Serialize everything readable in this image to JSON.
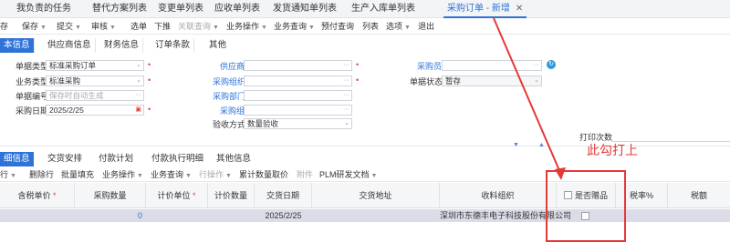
{
  "doc_tabs": [
    {
      "label": "我负责的任务"
    },
    {
      "label": "替代方案列表"
    },
    {
      "label": "变更单列表"
    },
    {
      "label": "应收单列表"
    },
    {
      "label": "发货通知单列表"
    },
    {
      "label": "生产入库单列表"
    },
    {
      "label": "采购订单 - 新增",
      "active": true
    }
  ],
  "toolbar": {
    "items": [
      "存",
      "保存",
      "提交",
      "审核",
      "选单",
      "下推",
      "关联查询",
      "业务操作",
      "业务查询",
      "预付查询",
      "列表",
      "选项",
      "退出"
    ]
  },
  "sections": [
    "本信息",
    "供应商信息",
    "财务信息",
    "订单条款",
    "其他"
  ],
  "form": {
    "doc_type_label": "单据类型",
    "doc_type_value": "标准采购订单",
    "biz_type_label": "业务类型",
    "biz_type_value": "标准采购",
    "doc_no_label": "单据编号",
    "doc_no_placeholder": "保存时自动生成",
    "purchase_date_label": "采购日期",
    "purchase_date_value": "2025/2/25",
    "supplier_label": "供应商",
    "purchase_org_label": "采购组织",
    "purchase_dept_label": "采购部门",
    "purchase_group_label": "采购组",
    "acceptance_label": "验收方式",
    "acceptance_value": "数量验收",
    "buyer_label": "采购员",
    "doc_status_label": "单据状态",
    "doc_status_value": "暂存",
    "print_count_label": "打印次数"
  },
  "detail_tabs": [
    "细信息",
    "交货安排",
    "付款计划",
    "付款执行明细",
    "其他信息"
  ],
  "detail_toolbar": [
    "行",
    "删除行",
    "批量填充",
    "业务操作",
    "业务查询",
    "行操作",
    "累计数量取价",
    "附件",
    "PLM研发文档"
  ],
  "grid": {
    "headers": [
      "含税单价",
      "采购数量",
      "计价单位",
      "计价数量",
      "交货日期",
      "交货地址",
      "收料组织",
      "是否赠品",
      "税率%",
      "税额"
    ],
    "row": {
      "qty": "0",
      "date": "2025/2/25",
      "org": "深圳市东德丰电子科技股份有限公司"
    }
  },
  "annotation": {
    "text": "此勾打上"
  },
  "colors": {
    "accent": "#2f73d8",
    "annotation": "#e53935"
  }
}
